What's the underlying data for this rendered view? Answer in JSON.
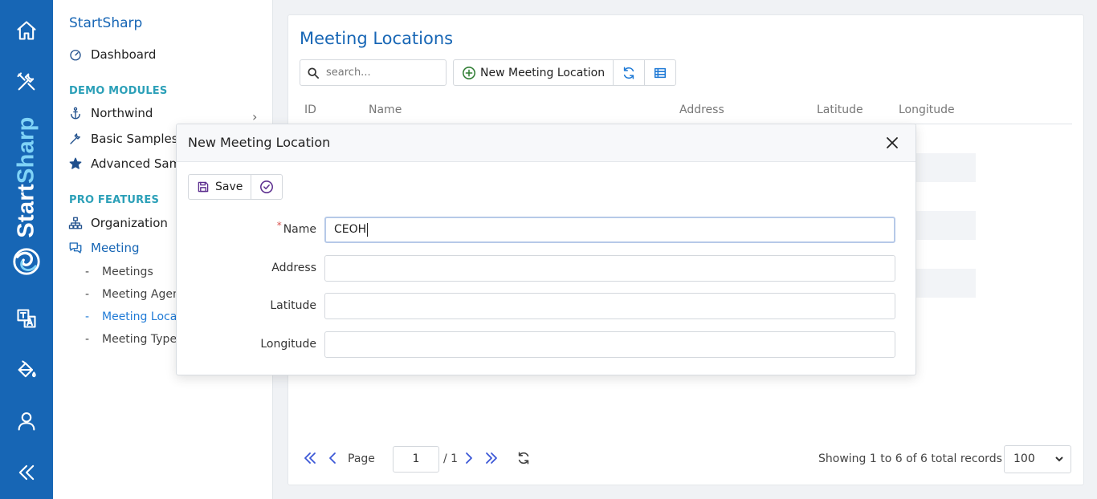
{
  "colors": {
    "primary": "#1766b5",
    "section": "#2ca0b8",
    "pager_accent": "#3b57d6"
  },
  "rail": {
    "brand_main": "Start",
    "brand_accent": "Sharp",
    "icons": [
      "home-icon",
      "tools-icon",
      "translate-icon",
      "paint-bucket-icon",
      "user-icon",
      "collapse-icon"
    ]
  },
  "sidebar": {
    "title": "StartSharp",
    "dashboard": "Dashboard",
    "section_demo": "DEMO MODULES",
    "northwind": "Northwind",
    "basic_samples": "Basic Samples",
    "advanced_samples": "Advanced Samples",
    "section_pro": "PRO FEATURES",
    "organization": "Organization",
    "meeting": "Meeting",
    "sub_items": [
      "Meetings",
      "Meeting Agenda Types",
      "Meeting Locations",
      "Meeting Types"
    ]
  },
  "main": {
    "title": "Meeting Locations",
    "search_placeholder": "search...",
    "new_button": "New Meeting Location",
    "columns": [
      "ID",
      "Name",
      "Address",
      "Latitude",
      "Longitude"
    ]
  },
  "pager": {
    "page_label": "Page",
    "page_value": "1",
    "page_total": "/ 1",
    "status": "Showing 1 to 6 of 6 total records",
    "page_size": "100"
  },
  "dialog": {
    "title": "New Meeting Location",
    "save_label": "Save",
    "fields": [
      {
        "label": "Name",
        "value": "CEOH",
        "required": "*"
      },
      {
        "label": "Address",
        "value": ""
      },
      {
        "label": "Latitude",
        "value": ""
      },
      {
        "label": "Longitude",
        "value": ""
      }
    ]
  }
}
